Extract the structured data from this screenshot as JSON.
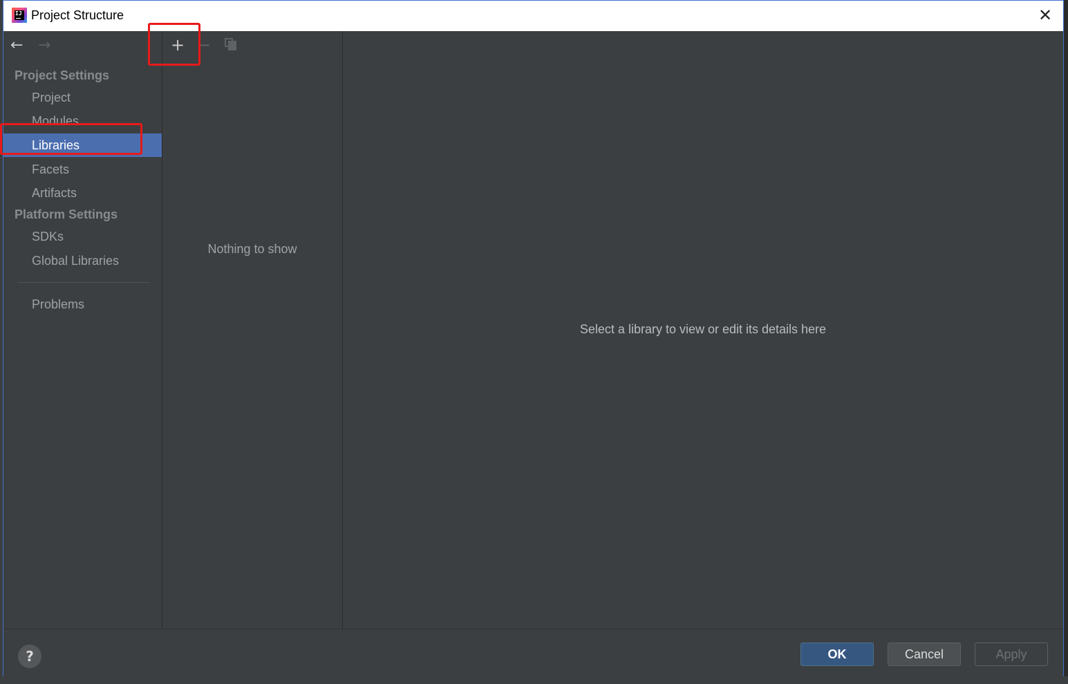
{
  "window": {
    "title": "Project Structure",
    "close_glyph": "✕"
  },
  "nav": {
    "back_glyph": "←",
    "forward_glyph": "→"
  },
  "sidebar": {
    "project_settings_title": "Project Settings",
    "project_items": [
      {
        "label": "Project",
        "selected": false
      },
      {
        "label": "Modules",
        "selected": false
      },
      {
        "label": "Libraries",
        "selected": true
      },
      {
        "label": "Facets",
        "selected": false
      },
      {
        "label": "Artifacts",
        "selected": false
      }
    ],
    "platform_settings_title": "Platform Settings",
    "platform_items": [
      {
        "label": "SDKs"
      },
      {
        "label": "Global Libraries"
      }
    ],
    "problems_label": "Problems"
  },
  "toolbar": {
    "add_glyph": "+",
    "remove_glyph": "−",
    "copy_icon": "copy-icon"
  },
  "list": {
    "empty_text": "Nothing to show"
  },
  "detail": {
    "hint": "Select a library to view or edit its details here"
  },
  "footer": {
    "help_glyph": "?",
    "ok_label": "OK",
    "cancel_label": "Cancel",
    "apply_label": "Apply"
  },
  "colors": {
    "selection": "#4b6eaf",
    "panel_bg": "#3c3f41",
    "highlight": "#e81a1a",
    "ok_button": "#365880"
  }
}
